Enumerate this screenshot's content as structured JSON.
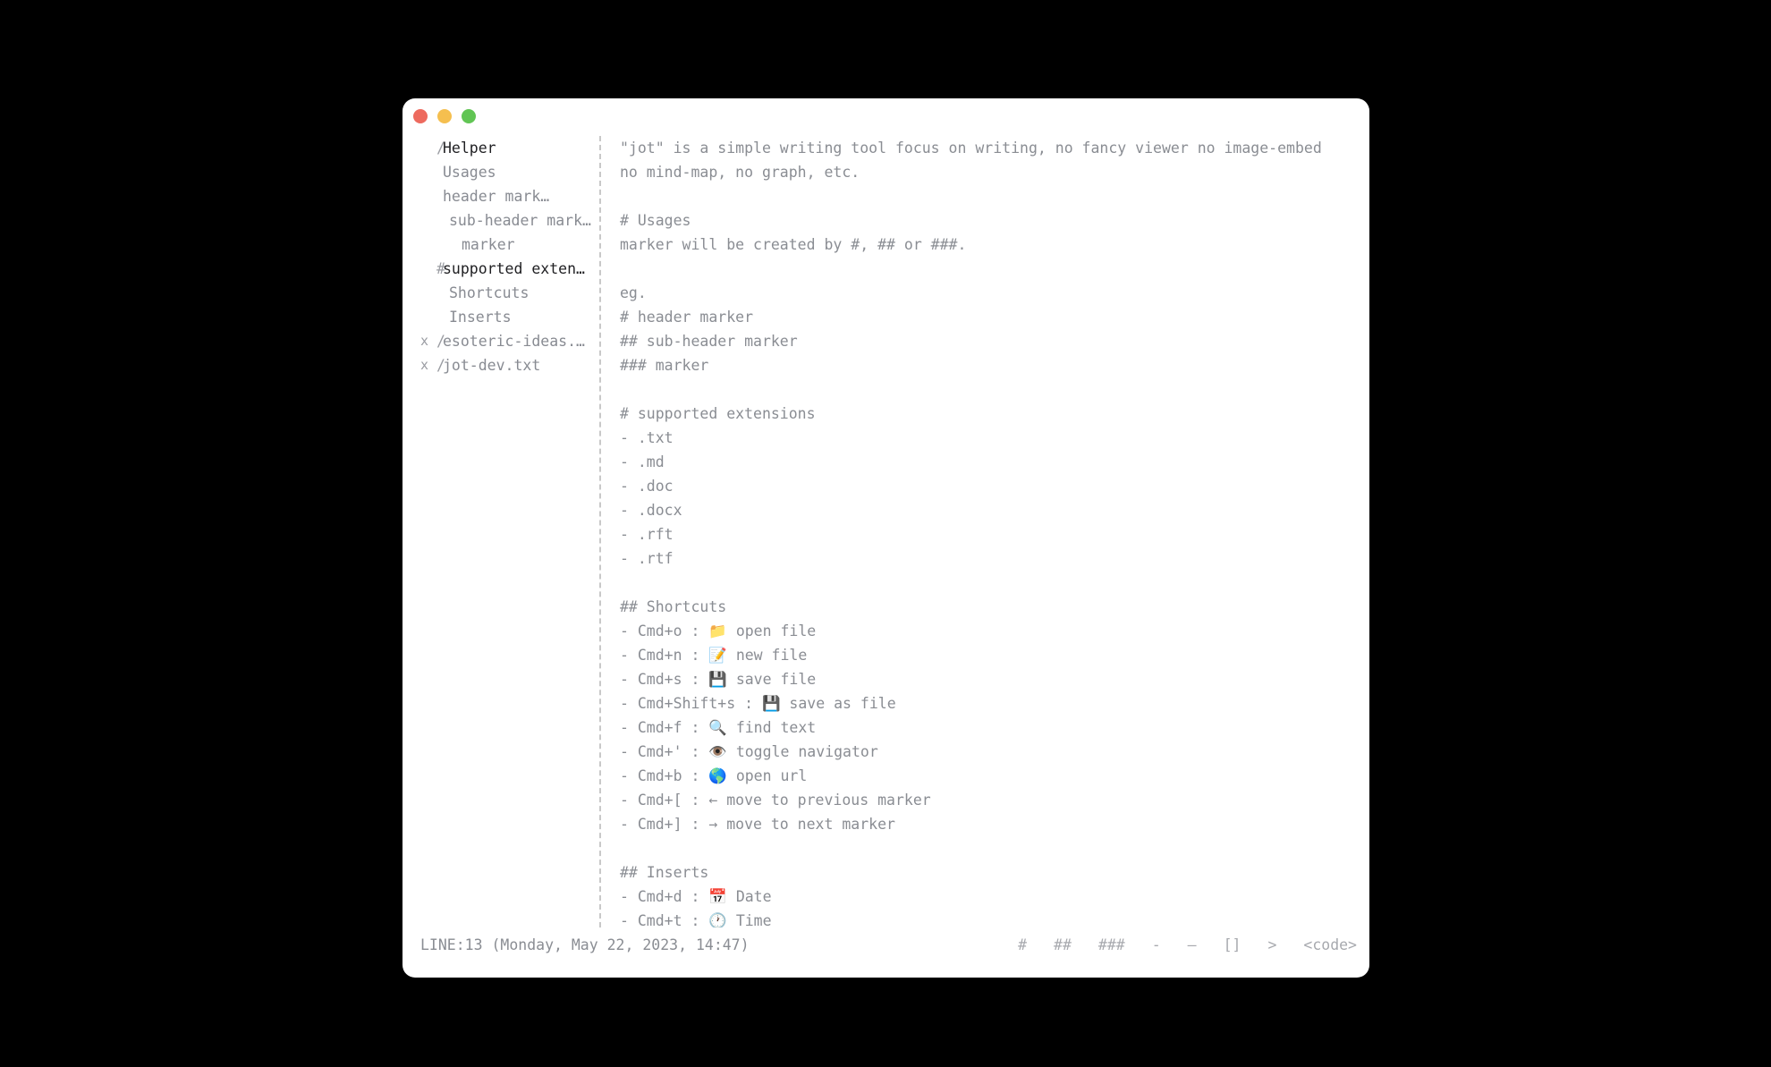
{
  "colors": {
    "background": "#000000",
    "window": "#ffffff",
    "text": "#8a8d93",
    "active_text": "#1f1f22"
  },
  "window": {
    "controls": [
      "close",
      "minimize",
      "maximize"
    ]
  },
  "navigator": {
    "items": [
      {
        "closer": "",
        "prefix": "/",
        "label": "Helper",
        "active": true
      },
      {
        "closer": "",
        "prefix": "",
        "label": "Usages",
        "active": false
      },
      {
        "closer": "",
        "prefix": "",
        "label": "header marker",
        "active": false
      },
      {
        "closer": "",
        "prefix": "",
        "label": "sub-header mark…",
        "active": false
      },
      {
        "closer": "",
        "prefix": "",
        "label": "marker",
        "active": false
      },
      {
        "closer": "",
        "prefix": "#",
        "label": "supported exten…",
        "active": true
      },
      {
        "closer": "",
        "prefix": "",
        "label": "Shortcuts",
        "active": false
      },
      {
        "closer": "",
        "prefix": "",
        "label": "Inserts",
        "active": false
      },
      {
        "closer": "x",
        "prefix": "/",
        "label": "esoteric-ideas.…",
        "active": false
      },
      {
        "closer": "x",
        "prefix": "/",
        "label": "jot-dev.txt",
        "active": false
      }
    ]
  },
  "editor": {
    "lines": [
      "\"jot\" is a simple writing tool focus on writing, no fancy viewer no image-embed",
      "no mind-map, no graph, etc.",
      "",
      "# Usages",
      "marker will be created by #, ## or ###.",
      "",
      "eg.",
      "# header marker",
      "## sub-header marker",
      "### marker",
      "",
      "# supported extensions",
      "- .txt",
      "- .md",
      "- .doc",
      "- .docx",
      "- .rft",
      "- .rtf",
      "",
      "## Shortcuts",
      "- Cmd+o : 📁 open file",
      "- Cmd+n : 📝 new file",
      "- Cmd+s : 💾 save file",
      "- Cmd+Shift+s : 💾 save as file",
      "- Cmd+f : 🔍 find text",
      "- Cmd+' : 👁️ toggle navigator",
      "- Cmd+b : 🌎 open url",
      "- Cmd+[ : ← move to previous marker",
      "- Cmd+] : → move to next marker",
      "",
      "## Inserts",
      "- Cmd+d : 📅 Date",
      "- Cmd+t : 🕐 Time"
    ]
  },
  "statusbar": {
    "text": "LINE:13 (Monday, May 22, 2023, 14:47)",
    "tools": [
      "#",
      "##",
      "###",
      "-",
      "—",
      "[]",
      ">",
      "<code>"
    ]
  }
}
